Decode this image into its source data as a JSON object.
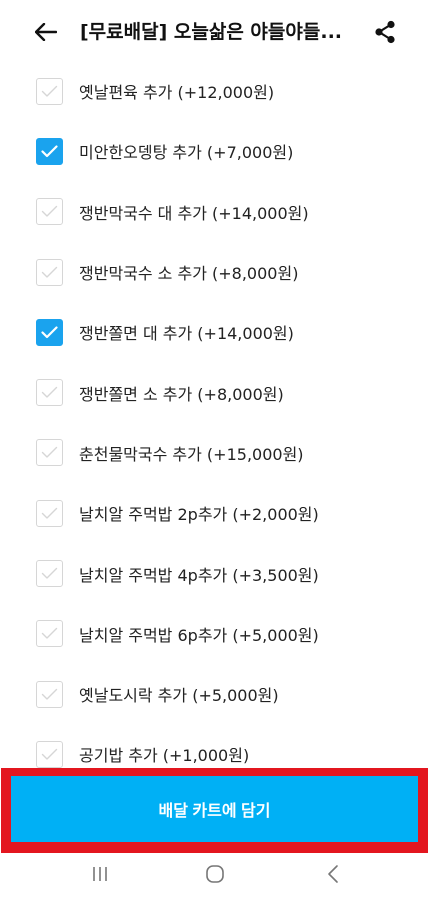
{
  "header": {
    "title": "[무료배달] 오늘삶은 야들야들...",
    "back_icon": "arrow-left-icon",
    "share_icon": "share-icon"
  },
  "options": [
    {
      "label": "옛날편육 추가 (+12,000원)",
      "checked": false
    },
    {
      "label": "미안한오뎅탕 추가 (+7,000원)",
      "checked": true
    },
    {
      "label": "쟁반막국수 대 추가 (+14,000원)",
      "checked": false
    },
    {
      "label": "쟁반막국수 소 추가 (+8,000원)",
      "checked": false
    },
    {
      "label": "쟁반쫄면 대 추가 (+14,000원)",
      "checked": true
    },
    {
      "label": "쟁반쫄면 소 추가 (+8,000원)",
      "checked": false
    },
    {
      "label": "춘천물막국수 추가 (+15,000원)",
      "checked": false
    },
    {
      "label": "날치알 주먹밥 2p추가 (+2,000원)",
      "checked": false
    },
    {
      "label": "날치알 주먹밥 4p추가 (+3,500원)",
      "checked": false
    },
    {
      "label": "날치알 주먹밥 6p추가 (+5,000원)",
      "checked": false
    },
    {
      "label": "옛날도시락 추가 (+5,000원)",
      "checked": false
    },
    {
      "label": "공기밥 추가 (+1,000원)",
      "checked": false
    }
  ],
  "cta": {
    "label": "배달 카트에 담기"
  },
  "nav": {
    "recents_icon": "recent-apps-icon",
    "home_icon": "home-icon",
    "back_icon": "nav-back-icon"
  },
  "colors": {
    "accent": "#00b0f5",
    "checkbox_checked": "#1aa3ee",
    "highlight_outline": "#e3161f"
  }
}
